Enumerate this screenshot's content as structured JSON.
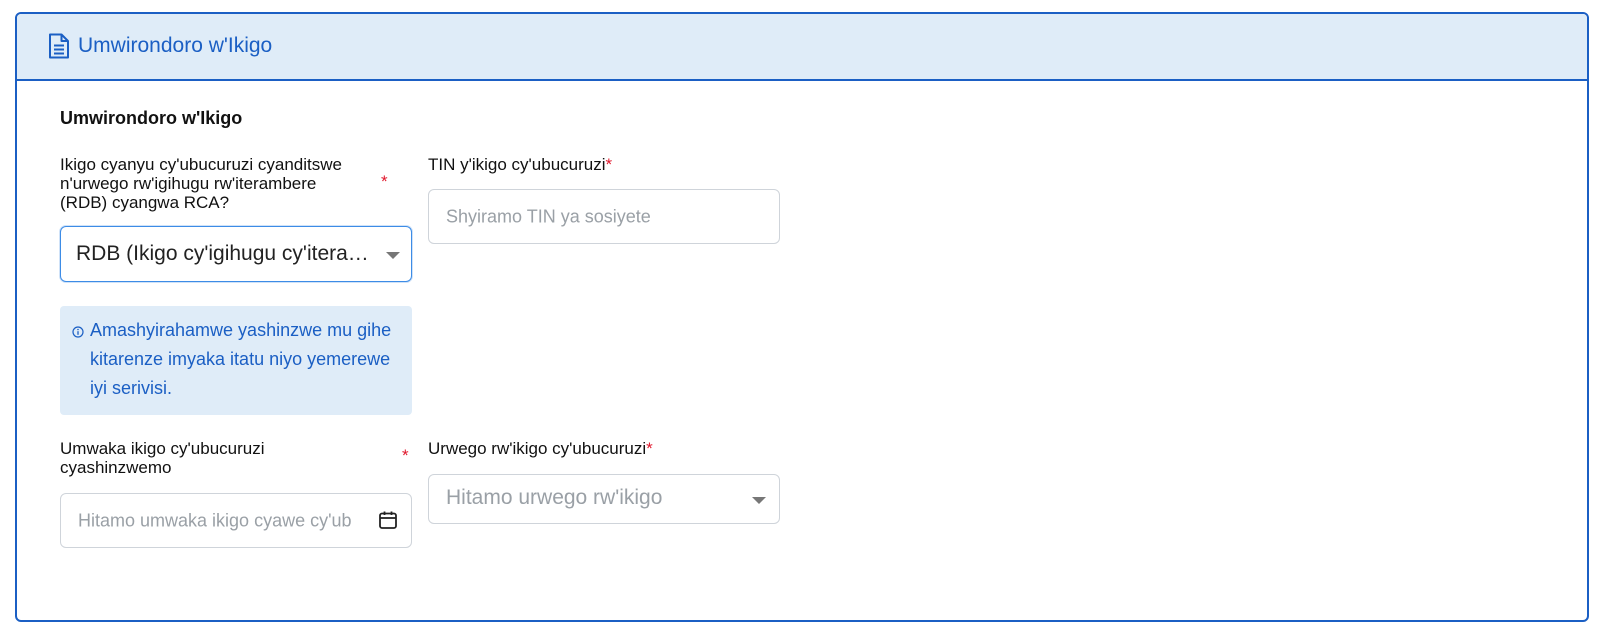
{
  "header": {
    "title": "Umwirondoro w'Ikigo",
    "icon": "document-icon"
  },
  "section": {
    "title": "Umwirondoro w'Ikigo"
  },
  "fields": {
    "registration": {
      "label_line1": "Ikigo cyanyu cy'ubucuruzi cyanditswe",
      "label_line2": "n'urwego rw'igihugu rw'iterambere",
      "label_line3": "(RDB) cyangwa RCA?",
      "required_mark": "*",
      "selected_value": "RDB (Ikigo cy'igihugu cy'iterambere)"
    },
    "tin": {
      "label": "TIN y'ikigo cy'ubucuruzi",
      "required_mark": "*",
      "placeholder": "Shyiramo TIN ya sosiyete"
    },
    "info": {
      "icon": "info-icon",
      "text": "Amashyirahamwe yashinzwe mu gihe kitarenze imyaka itatu niyo yemerewe iyi serivisi."
    },
    "year": {
      "label_line1": "Umwaka ikigo cy'ubucuruzi",
      "label_line2": "cyashinzwemo",
      "required_mark": "*",
      "placeholder": "Hitamo umwaka ikigo cyawe cy'ub",
      "icon": "calendar-icon"
    },
    "level": {
      "label": "Urwego rw'ikigo cy'ubucuruzi",
      "required_mark": "*",
      "placeholder": "Hitamo urwego rw'ikigo"
    }
  },
  "colors": {
    "accent": "#1b5fc4",
    "header_bg": "#dfecf8",
    "required": "#e0162b"
  }
}
